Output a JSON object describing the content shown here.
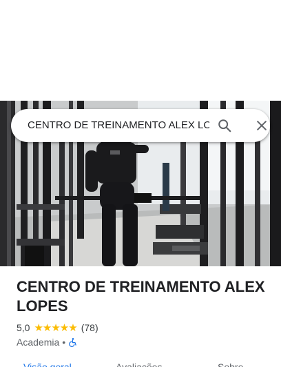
{
  "search": {
    "query": "CENTRO DE TREINAMENTO ALEX LOPES"
  },
  "place": {
    "title": "CENTRO DE TREINAMENTO ALEX LOPES",
    "rating": "5,0",
    "stars": "★★★★★",
    "review_count": "(78)",
    "category": "Academia",
    "separator": "•"
  },
  "tabs": [
    {
      "label": "Visão geral"
    },
    {
      "label": "Avaliações"
    },
    {
      "label": "Sobre"
    }
  ],
  "colors": {
    "star": "#fbbc04",
    "accent": "#1a73e8",
    "accessibility": "#1a73e8"
  },
  "icons": {
    "search": "search-icon",
    "close": "close-icon",
    "accessibility": "wheelchair-icon"
  }
}
